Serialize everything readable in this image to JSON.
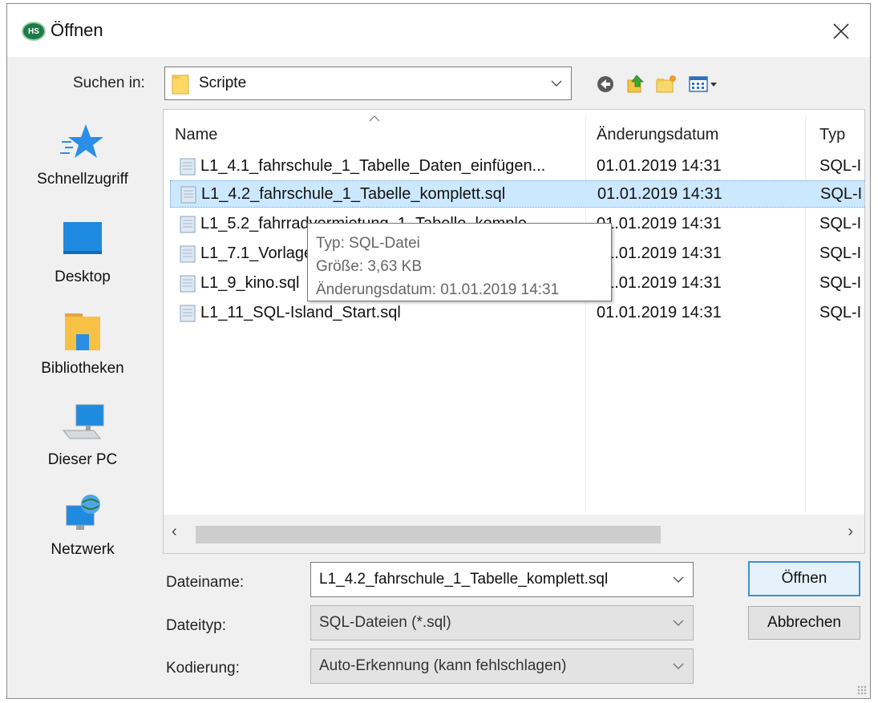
{
  "window": {
    "title": "Öffnen",
    "app_icon_text": "HS"
  },
  "lookin": {
    "label": "Suchen in:",
    "value": "Scripte"
  },
  "toolbar": {
    "icons": [
      "back-icon",
      "up-folder-icon",
      "new-folder-icon",
      "view-menu-icon"
    ]
  },
  "sidebar": {
    "items": [
      {
        "label": "Schnellzugriff",
        "icon": "star-icon"
      },
      {
        "label": "Desktop",
        "icon": "desktop-icon"
      },
      {
        "label": "Bibliotheken",
        "icon": "libraries-icon"
      },
      {
        "label": "Dieser PC",
        "icon": "computer-icon"
      },
      {
        "label": "Netzwerk",
        "icon": "network-icon"
      }
    ]
  },
  "filelist": {
    "columns": {
      "name": "Name",
      "date": "Änderungsdatum",
      "type": "Typ"
    },
    "rows": [
      {
        "name": "L1_4.1_fahrschule_1_Tabelle_Daten_einfügen...",
        "date": "01.01.2019 14:31",
        "type": "SQL-I"
      },
      {
        "name": "L1_4.2_fahrschule_1_Tabelle_komplett.sql",
        "date": "01.01.2019 14:31",
        "type": "SQL-I"
      },
      {
        "name": "L1_5.2_fahrradvermietung_1_Tabelle_komple...",
        "date": "01.01.2019 14:31",
        "type": "SQL-I"
      },
      {
        "name": "L1_7.1_Vorlage",
        "date": "01.01.2019 14:31",
        "type": "SQL-I"
      },
      {
        "name": "L1_9_kino.sql",
        "date": "01.01.2019 14:31",
        "type": "SQL-I"
      },
      {
        "name": "L1_11_SQL-Island_Start.sql",
        "date": "01.01.2019 14:31",
        "type": "SQL-I"
      }
    ],
    "selected_index": 1
  },
  "tooltip": {
    "line1": "Typ: SQL-Datei",
    "line2": "Größe: 3,63 KB",
    "line3": "Änderungsdatum: 01.01.2019 14:31"
  },
  "form": {
    "filename_label": "Dateiname:",
    "filename_value": "L1_4.2_fahrschule_1_Tabelle_komplett.sql",
    "filetype_label": "Dateityp:",
    "filetype_value": "SQL-Dateien (*.sql)",
    "encoding_label": "Kodierung:",
    "encoding_value": "Auto-Erkennung (kann fehlschlagen)"
  },
  "buttons": {
    "open": "Öffnen",
    "cancel": "Abbrechen"
  }
}
